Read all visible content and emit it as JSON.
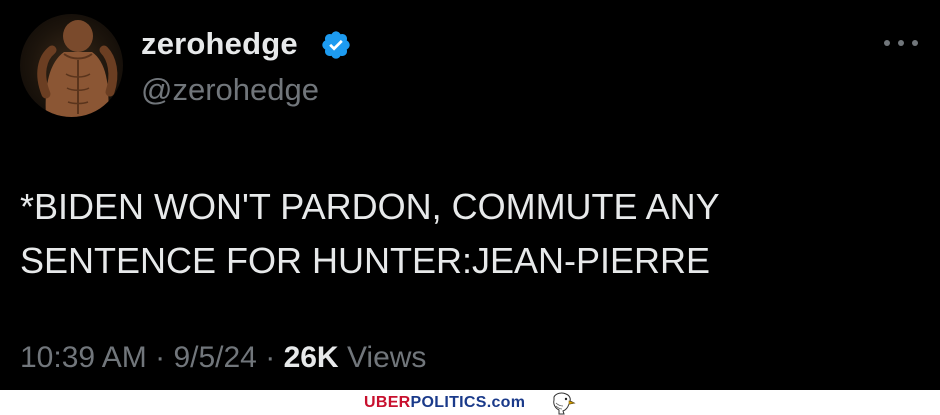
{
  "tweet": {
    "display_name": "zerohedge",
    "handle": "@zerohedge",
    "verified_icon": "verified-badge-icon",
    "more_icon": "more-options-icon",
    "text": "*BIDEN WON'T PARDON, COMMUTE ANY\nSENTENCE FOR HUNTER:JEAN-PIERRE",
    "time": "10:39 AM",
    "date": "9/5/24",
    "separator": "·",
    "views_count": "26K",
    "views_label": "Views"
  },
  "watermark": {
    "brand_part1": "UBER",
    "brand_part2": "POLITICS.com",
    "logo_icon": "eagle-icon"
  },
  "colors": {
    "background": "#000000",
    "text_primary": "#e7e9ea",
    "text_secondary": "#71767b",
    "verified_blue": "#1d9bf0",
    "brand_red": "#c8102e",
    "brand_blue": "#1a3a8a"
  }
}
